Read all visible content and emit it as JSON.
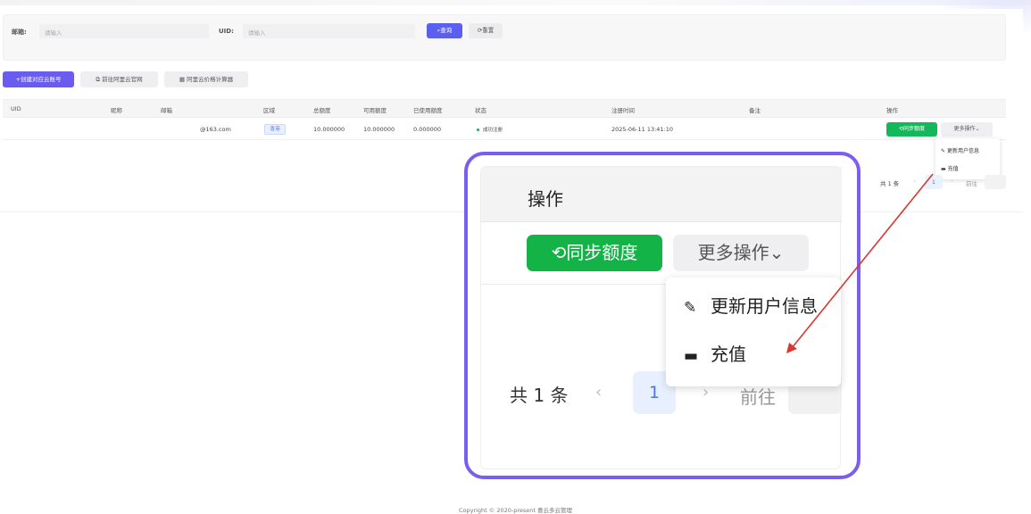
{
  "search": {
    "email_label": "邮箱:",
    "email_placeholder": "请输入",
    "uid_label": "UID:",
    "uid_placeholder": "请输入",
    "query_button": "⌕查询",
    "reset_button": "⟳重置"
  },
  "actions": {
    "create": "+创建对应云账号",
    "aliyun_site": "⧉ 前往阿里云官网",
    "price_calc": "▦ 阿里云价格计算器"
  },
  "table": {
    "headers": [
      "UID",
      "昵称",
      "邮箱",
      "区域",
      "总额度",
      "可用额度",
      "已使用额度",
      "状态",
      "注册时间",
      "备注",
      "操作"
    ],
    "row": {
      "email": "@163.com",
      "region": "香港",
      "total": "10.000000",
      "available": "10.000000",
      "used": "0.000000",
      "status": "成功注册",
      "registered": "2025-06-11 13:41:10",
      "sync_button": "⟲同步额度",
      "more_button": "更多操作⌄"
    }
  },
  "dropdown": {
    "update_user": "更新用户信息",
    "recharge": "充值"
  },
  "pagination": {
    "total": "共 1 条",
    "page": "1",
    "goto": "前往"
  },
  "zoom": {
    "header": "操作",
    "sync_button": "⟲同步额度",
    "more_button": "更多操作⌄",
    "update_user": "更新用户信息",
    "recharge": "充值",
    "total": "共 1 条",
    "page": "1",
    "goto": "前往"
  },
  "footer": "Copyright © 2020-present 喜云多云管理",
  "colors": {
    "primary": "#5b5ff0",
    "success": "#13b347",
    "callout_border": "#7b5df0",
    "arrow": "#d9372f"
  }
}
